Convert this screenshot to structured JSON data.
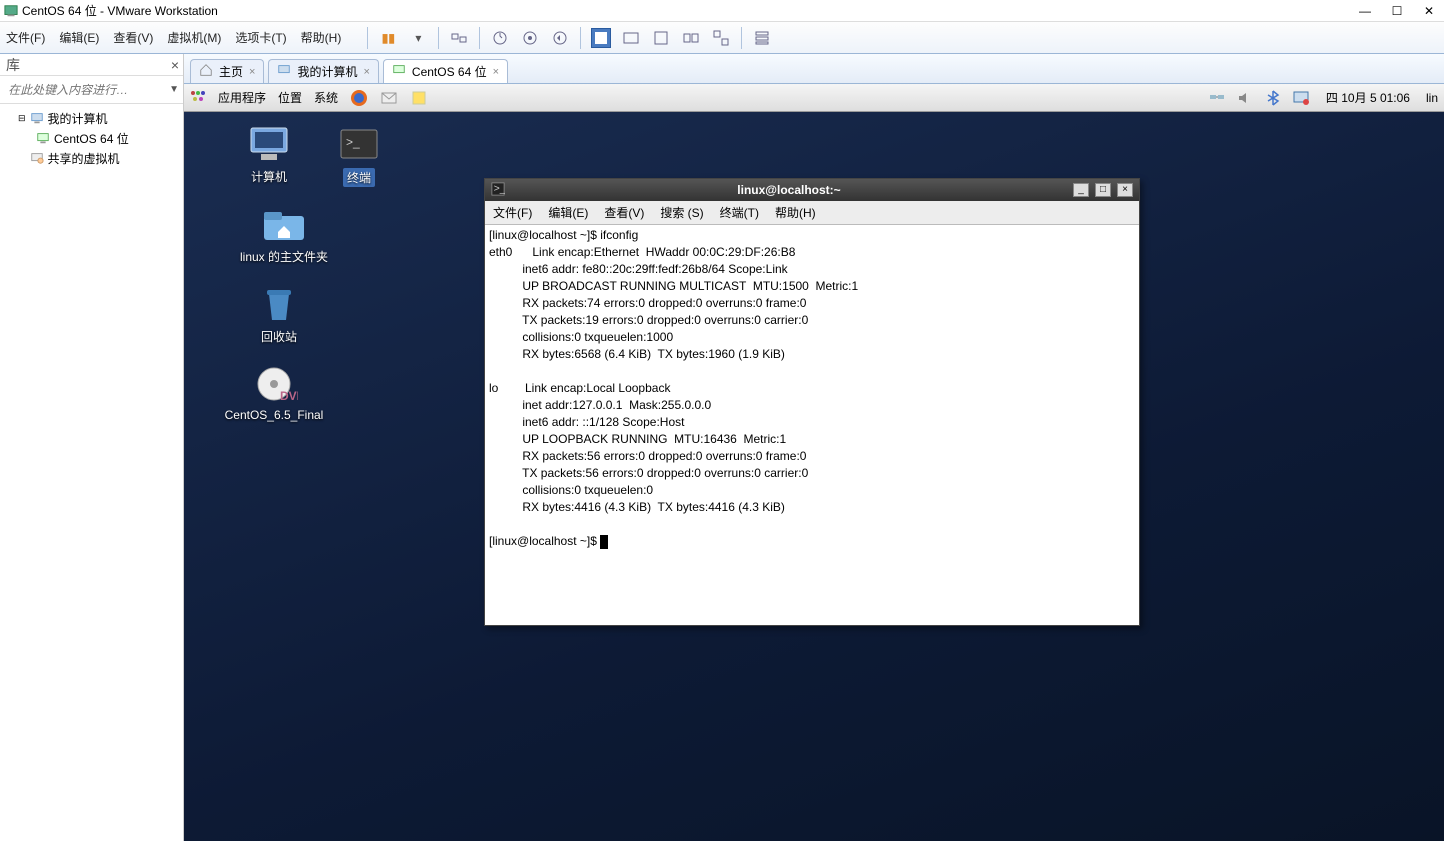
{
  "window": {
    "title": "CentOS 64 位 - VMware Workstation",
    "minimize": "—",
    "maximize": "☐",
    "close": "✕"
  },
  "menu": {
    "file": "文件(F)",
    "edit": "编辑(E)",
    "view": "查看(V)",
    "vm": "虚拟机(M)",
    "tabs": "选项卡(T)",
    "help": "帮助(H)"
  },
  "sidebar": {
    "header_label": "库",
    "search_placeholder": "在此处键入内容进行…",
    "nodes": {
      "root": "我的计算机",
      "vm": "CentOS 64 位",
      "shared": "共享的虚拟机"
    }
  },
  "tabs": {
    "home": "主页",
    "mycomputer": "我的计算机",
    "centos": "CentOS 64 位"
  },
  "gnome": {
    "apps": "应用程序",
    "places": "位置",
    "system": "系统",
    "date": "四 10月  5 01:06",
    "user": "lin"
  },
  "desktop": {
    "computer": "计算机",
    "terminal": "终端",
    "home": "linux 的主文件夹",
    "trash": "回收站",
    "cd": "CentOS_6.5_Final"
  },
  "terminal": {
    "title": "linux@localhost:~",
    "menu": {
      "file": "文件(F)",
      "edit": "编辑(E)",
      "view": "查看(V)",
      "search": "搜索 (S)",
      "terminal": "终端(T)",
      "help": "帮助(H)"
    },
    "minimize": "_",
    "maximize": "□",
    "close": "×",
    "content": "[linux@localhost ~]$ ifconfig\neth0      Link encap:Ethernet  HWaddr 00:0C:29:DF:26:B8\n          inet6 addr: fe80::20c:29ff:fedf:26b8/64 Scope:Link\n          UP BROADCAST RUNNING MULTICAST  MTU:1500  Metric:1\n          RX packets:74 errors:0 dropped:0 overruns:0 frame:0\n          TX packets:19 errors:0 dropped:0 overruns:0 carrier:0\n          collisions:0 txqueuelen:1000\n          RX bytes:6568 (6.4 KiB)  TX bytes:1960 (1.9 KiB)\n\nlo        Link encap:Local Loopback\n          inet addr:127.0.0.1  Mask:255.0.0.0\n          inet6 addr: ::1/128 Scope:Host\n          UP LOOPBACK RUNNING  MTU:16436  Metric:1\n          RX packets:56 errors:0 dropped:0 overruns:0 frame:0\n          TX packets:56 errors:0 dropped:0 overruns:0 carrier:0\n          collisions:0 txqueuelen:0\n          RX bytes:4416 (4.3 KiB)  TX bytes:4416 (4.3 KiB)\n\n[linux@localhost ~]$ "
  }
}
